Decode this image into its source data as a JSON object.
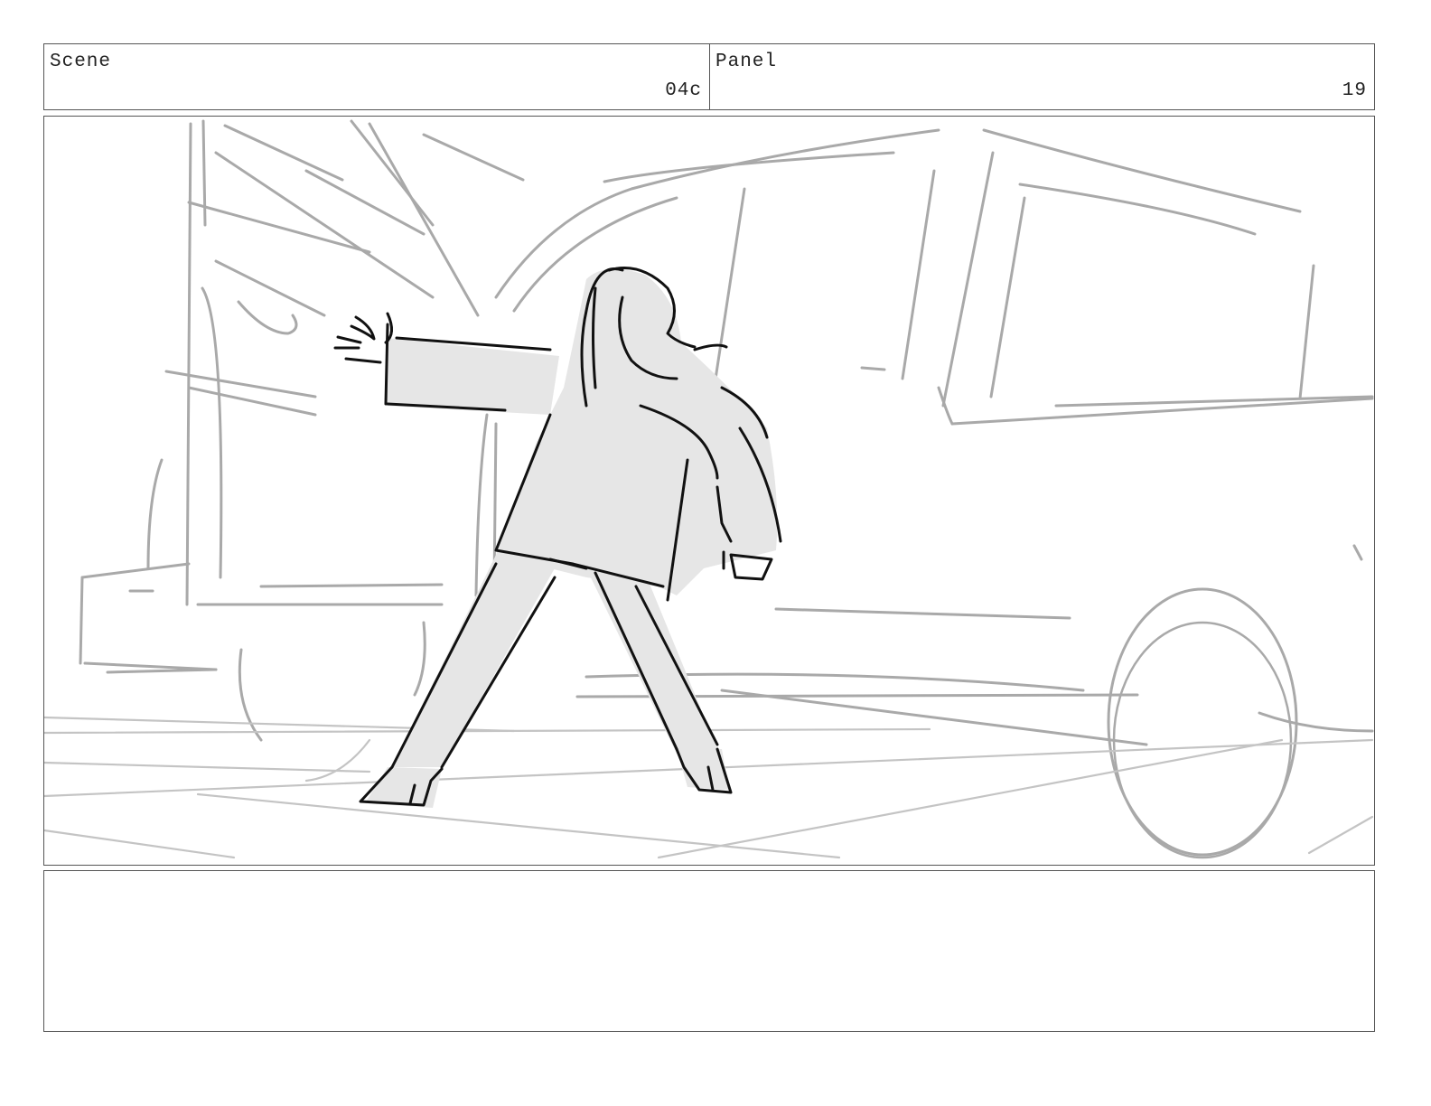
{
  "scene": {
    "label": "Scene",
    "value": "04c"
  },
  "panel": {
    "label": "Panel",
    "value": "19"
  },
  "artwork": {
    "subject": "woman-reaching-toward-car-door",
    "stroke_colors": {
      "background": "#a9a9a9",
      "figure": "#111111",
      "fill": "#e6e6e6"
    }
  },
  "notes": {
    "text": ""
  }
}
